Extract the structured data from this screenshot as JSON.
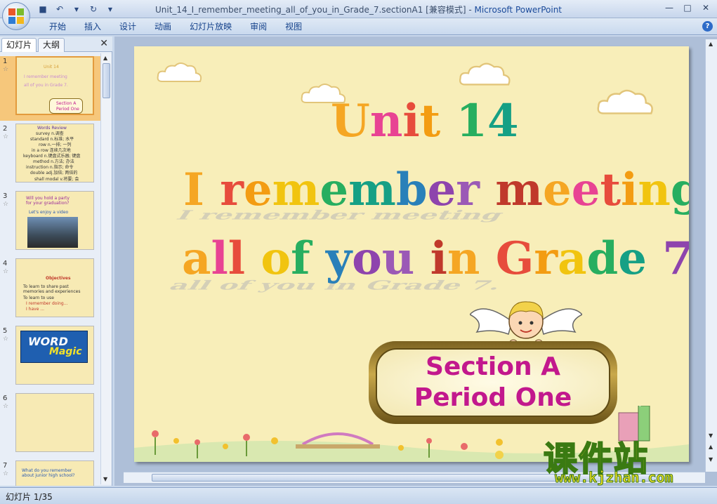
{
  "window": {
    "title": "Unit_14_I_remember_meeting_all_of_you_in_Grade_7.sectionA1 [兼容模式]",
    "separator": " - ",
    "app_name": "Microsoft PowerPoint"
  },
  "ribbon": {
    "tabs": [
      "开始",
      "插入",
      "设计",
      "动画",
      "幻灯片放映",
      "审阅",
      "视图"
    ]
  },
  "panel": {
    "tab_slides": "幻灯片",
    "tab_outline": "大纲",
    "thumbs": [
      {
        "num": "1",
        "lines": [
          "Unit 14",
          "I remember meeting",
          "all of you in Grade 7."
        ],
        "box": [
          "Section A",
          "Period One"
        ]
      },
      {
        "num": "2",
        "lines": [
          "Words Review",
          "survey n.调查",
          "standard n.标准; 水平",
          "row n.一排; 一列",
          "in a row 连续几次地",
          "keyboard n.键盘式乐器; 键盘",
          "method n.方法; 办法",
          "instruction n.指示; 命令",
          "double adj.加倍; 两倍的",
          "shall modal v.将要; 会"
        ]
      },
      {
        "num": "3",
        "lines": [
          "Will you hold a party for your graduation?",
          "Let's enjoy a video"
        ]
      },
      {
        "num": "4",
        "title": "Objectives",
        "lines": [
          "To learn to share past memories and experiences",
          "To learn to use",
          "I remember doing...",
          "I have ..."
        ]
      },
      {
        "num": "5",
        "lines": [
          "WORD",
          "Magic"
        ]
      },
      {
        "num": "6",
        "lines": []
      },
      {
        "num": "7",
        "lines": [
          "What do you remember about junior high school?"
        ]
      }
    ]
  },
  "slide": {
    "title_line1": "Unit 14",
    "title_line2": "I remember meeting",
    "title_line3": "all of you in Grade 7.",
    "section": "Section A",
    "period": "Period One"
  },
  "watermark": {
    "brand": "课件站",
    "url": "www.kjzhan.com"
  },
  "status": {
    "slide_counter": "幻灯片 1/35"
  },
  "colors": {
    "slide_bg": "#f8eeb9",
    "section_text": "#c2188d",
    "ribbon_text": "#15428b",
    "selection": "#f6c77b"
  }
}
